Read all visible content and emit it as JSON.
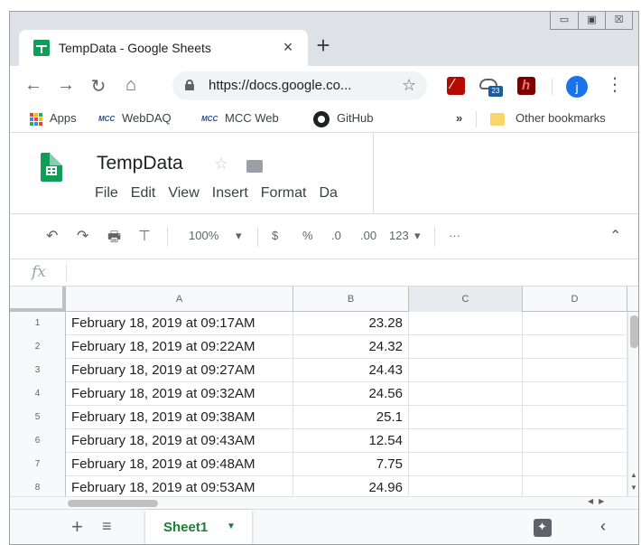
{
  "browser": {
    "tab_title": "TempData - Google Sheets",
    "tab_close": "×",
    "new_tab": "+",
    "window_controls": [
      "▭",
      "▣",
      "☒"
    ],
    "url": "https://docs.google.co...",
    "avatar_initial": "j",
    "cloud_badge": "23",
    "bookmarks": [
      "Apps",
      "WebDAQ",
      "MCC Web",
      "GitHub"
    ],
    "bookmarks_overflow": "»",
    "other_bookmarks": "Other bookmarks",
    "mcc_logo_text": "MCC"
  },
  "sheets": {
    "doc_title": "TempData",
    "menu": [
      "File",
      "Edit",
      "View",
      "Insert",
      "Format",
      "Da"
    ],
    "toolbar": {
      "zoom": "100%",
      "currency": "$",
      "percent": "%",
      "decrease_decimal": ".0",
      "increase_decimal": ".00",
      "more_formats": "123",
      "more": "···"
    },
    "formula_label": "fx",
    "columns": [
      "A",
      "B",
      "C",
      "D"
    ],
    "rows": [
      {
        "num": "1",
        "a": "February 18, 2019 at 09:17AM",
        "b": "23.28"
      },
      {
        "num": "2",
        "a": "February 18, 2019 at 09:22AM",
        "b": "24.32"
      },
      {
        "num": "3",
        "a": "February 18, 2019 at 09:27AM",
        "b": "24.43"
      },
      {
        "num": "4",
        "a": "February 18, 2019 at 09:32AM",
        "b": "24.56"
      },
      {
        "num": "5",
        "a": "February 18, 2019 at 09:38AM",
        "b": "25.1"
      },
      {
        "num": "6",
        "a": "February 18, 2019 at 09:43AM",
        "b": "12.54"
      },
      {
        "num": "7",
        "a": "February 18, 2019 at 09:48AM",
        "b": "7.75"
      },
      {
        "num": "8",
        "a": "February 18, 2019 at 09:53AM",
        "b": "24.96"
      }
    ],
    "sheet_tab": "Sheet1"
  },
  "colors": {
    "sheets_green": "#0f9d58",
    "tab_green": "#188038",
    "chrome_gray": "#dee1e6",
    "avatar_blue": "#1a73e8"
  }
}
